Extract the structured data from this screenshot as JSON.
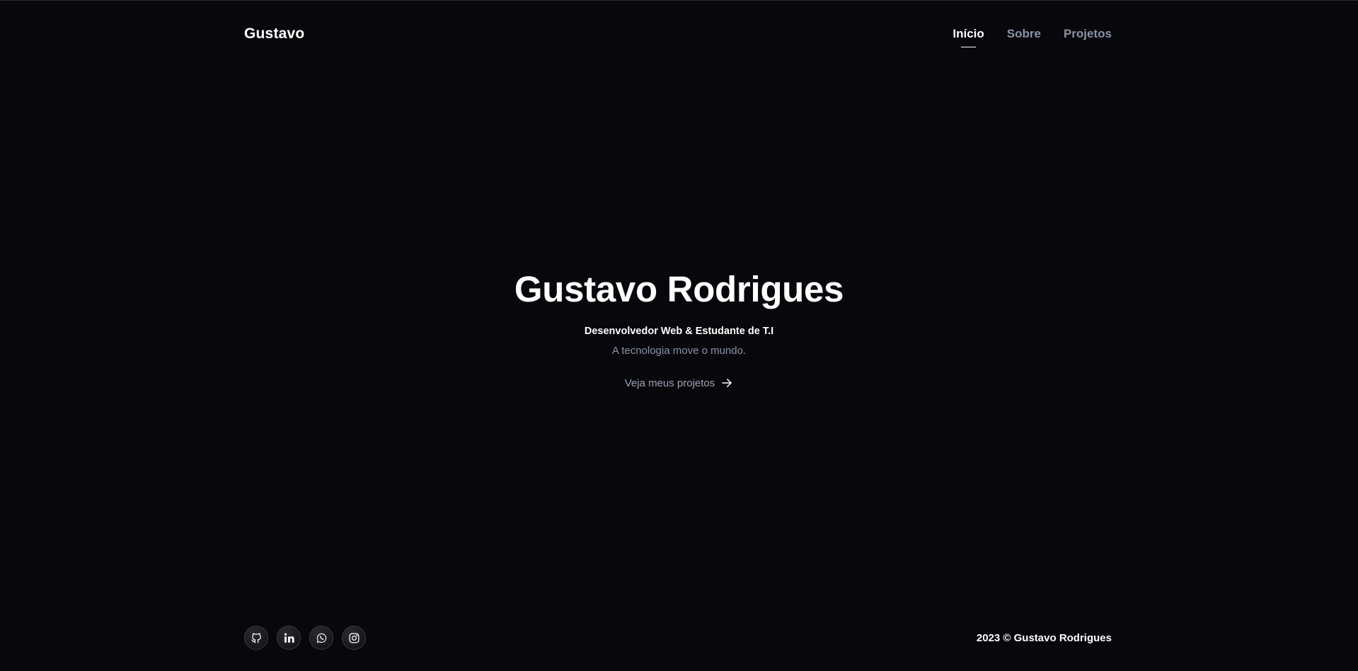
{
  "header": {
    "brand": "Gustavo",
    "nav": [
      {
        "label": "Início",
        "active": true
      },
      {
        "label": "Sobre",
        "active": false
      },
      {
        "label": "Projetos",
        "active": false
      }
    ]
  },
  "hero": {
    "title": "Gustavo Rodrigues",
    "subtitle": "Desenvolvedor Web & Estudante de T.I",
    "tagline": "A tecnologia move o mundo.",
    "cta_label": "Veja meus projetos",
    "cta_icon": "arrow-right-icon"
  },
  "footer": {
    "socials": [
      {
        "icon": "github-icon"
      },
      {
        "icon": "linkedin-icon"
      },
      {
        "icon": "whatsapp-icon"
      },
      {
        "icon": "instagram-icon"
      }
    ],
    "copyright": "2023 © Gustavo Rodrigues"
  },
  "colors": {
    "background": "#08080c",
    "text_primary": "#ffffff",
    "text_muted": "#8a93a6"
  }
}
